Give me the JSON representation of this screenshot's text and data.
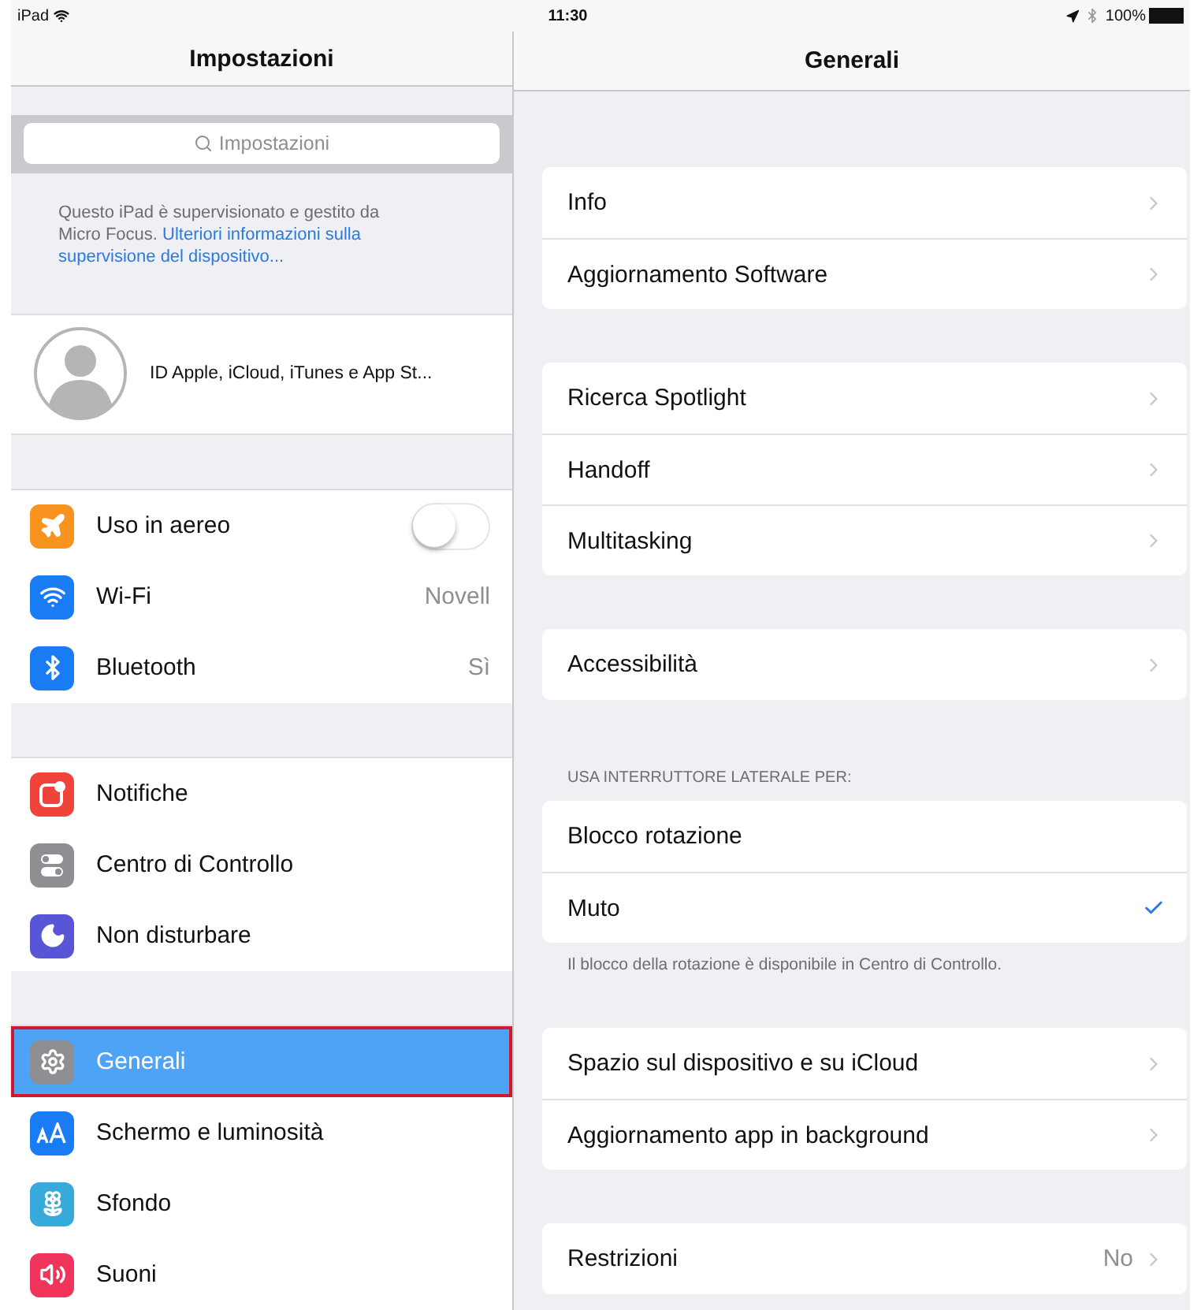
{
  "status_bar": {
    "device": "iPad",
    "time": "11:30",
    "battery": "100%"
  },
  "sidebar": {
    "title": "Impostazioni",
    "search": {
      "placeholder": "Impostazioni"
    },
    "notice": {
      "text": "Questo iPad è supervisionato e gestito da Micro Focus.",
      "link": [
        "Ulteriori informazioni sulla",
        "supervisione del dispositivo..."
      ]
    },
    "account": {
      "label": "ID Apple, iCloud, iTunes e App St..."
    },
    "sections": [
      [
        {
          "label": "Uso in aereo",
          "kind": "toggle",
          "on": false,
          "color": "#f7931e",
          "selected": false
        },
        {
          "label": "Wi-Fi",
          "kind": "value",
          "value": "Novell",
          "color": "#1a7cf5",
          "selected": false
        },
        {
          "label": "Bluetooth",
          "kind": "value",
          "value": "Sì",
          "color": "#1a7cf5",
          "selected": false
        }
      ],
      [
        {
          "label": "Notifiche",
          "kind": "plain",
          "color": "#f0443a",
          "selected": false
        },
        {
          "label": "Centro di Controllo",
          "kind": "plain",
          "color": "#8e8e93",
          "selected": false
        },
        {
          "label": "Non disturbare",
          "kind": "plain",
          "color": "#5856d6",
          "selected": false
        }
      ],
      [
        {
          "label": "Generali",
          "kind": "plain",
          "color": "#8e8e93",
          "selected": true
        },
        {
          "label": "Schermo e luminosità",
          "kind": "plain",
          "color": "#1a7cf5",
          "selected": false
        },
        {
          "label": "Sfondo",
          "kind": "plain",
          "color": "#37aadc",
          "selected": false
        },
        {
          "label": "Suoni",
          "kind": "plain",
          "color": "#f0345a",
          "selected": false
        }
      ]
    ]
  },
  "detail": {
    "title": "Generali",
    "groups": [
      {
        "rows": [
          {
            "label": "Info",
            "kind": "chevron"
          },
          {
            "label": "Aggiornamento Software",
            "kind": "chevron"
          }
        ]
      },
      {
        "rows": [
          {
            "label": "Ricerca Spotlight",
            "kind": "chevron"
          },
          {
            "label": "Handoff",
            "kind": "chevron"
          },
          {
            "label": "Multitasking",
            "kind": "chevron"
          }
        ]
      },
      {
        "rows": [
          {
            "label": "Accessibilità",
            "kind": "chevron"
          }
        ]
      },
      {
        "header": "USA INTERRUTTORE LATERALE PER:",
        "footer": "Il blocco della rotazione è disponibile in Centro di Controllo.",
        "rows": [
          {
            "label": "Blocco rotazione",
            "kind": "option",
            "selected": false
          },
          {
            "label": "Muto",
            "kind": "option",
            "selected": true
          }
        ]
      },
      {
        "rows": [
          {
            "label": "Spazio sul dispositivo e su iCloud",
            "kind": "chevron"
          },
          {
            "label": "Aggiornamento app in background",
            "kind": "chevron"
          }
        ]
      },
      {
        "rows": [
          {
            "label": "Restrizioni",
            "kind": "chevron",
            "value": "No"
          }
        ]
      }
    ]
  }
}
